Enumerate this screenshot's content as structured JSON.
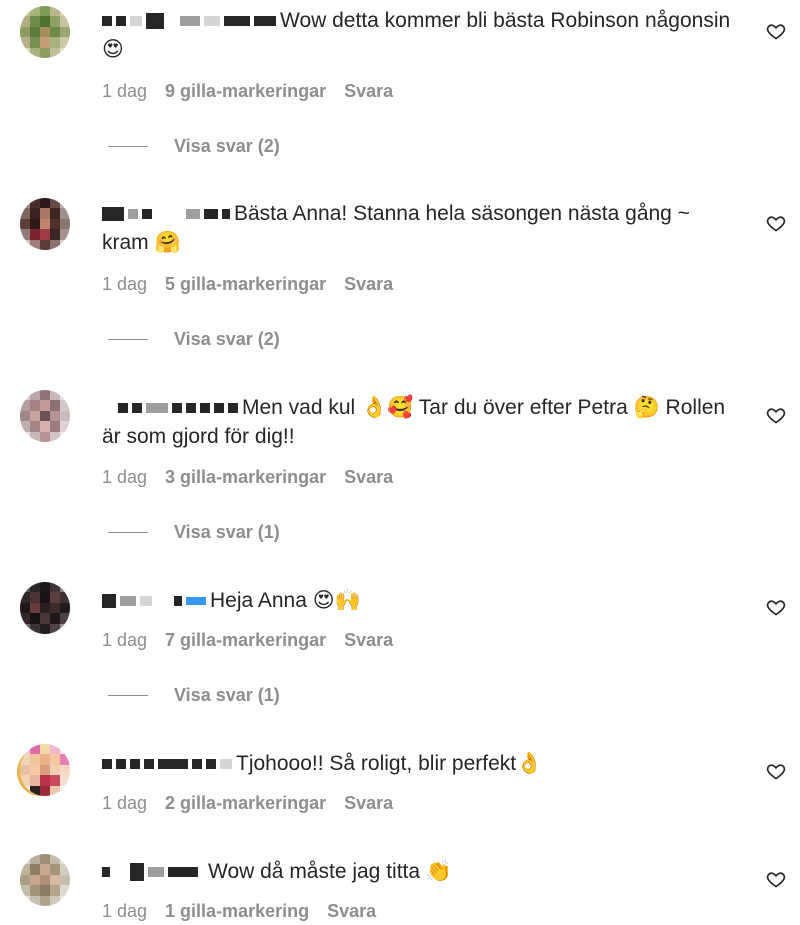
{
  "comments": [
    {
      "text": "Wow detta kommer bli bästa Robinson någonsin 😍",
      "time": "1 dag",
      "likes": "9 gilla-markeringar",
      "reply": "Svara",
      "view_replies": "Visa svar (2)",
      "heart_icon": "heart-outline-icon"
    },
    {
      "text": "Bästa Anna! Stanna hela säsongen nästa gång ~ kram 🤗",
      "time": "1 dag",
      "likes": "5 gilla-markeringar",
      "reply": "Svara",
      "view_replies": "Visa svar (2)",
      "heart_icon": "heart-outline-icon"
    },
    {
      "text": "Men vad kul 👌🥰 Tar du över efter Petra 🤔 Rollen är som gjord för dig!!",
      "time": "1 dag",
      "likes": "3 gilla-markeringar",
      "reply": "Svara",
      "view_replies": "Visa svar (1)",
      "heart_icon": "heart-outline-icon"
    },
    {
      "text": "Heja Anna 😍🙌",
      "time": "1 dag",
      "likes": "7 gilla-markeringar",
      "reply": "Svara",
      "view_replies": "Visa svar (1)",
      "heart_icon": "heart-outline-icon"
    },
    {
      "text": "Tjohooo!! Så roligt, blir perfekt👌",
      "time": "1 dag",
      "likes": "2 gilla-markeringar",
      "reply": "Svara",
      "heart_icon": "heart-outline-icon"
    },
    {
      "text": "Wow då måste jag titta 👏",
      "time": "1 dag",
      "likes": "1 gilla-markering",
      "reply": "Svara",
      "heart_icon": "heart-outline-icon"
    }
  ]
}
